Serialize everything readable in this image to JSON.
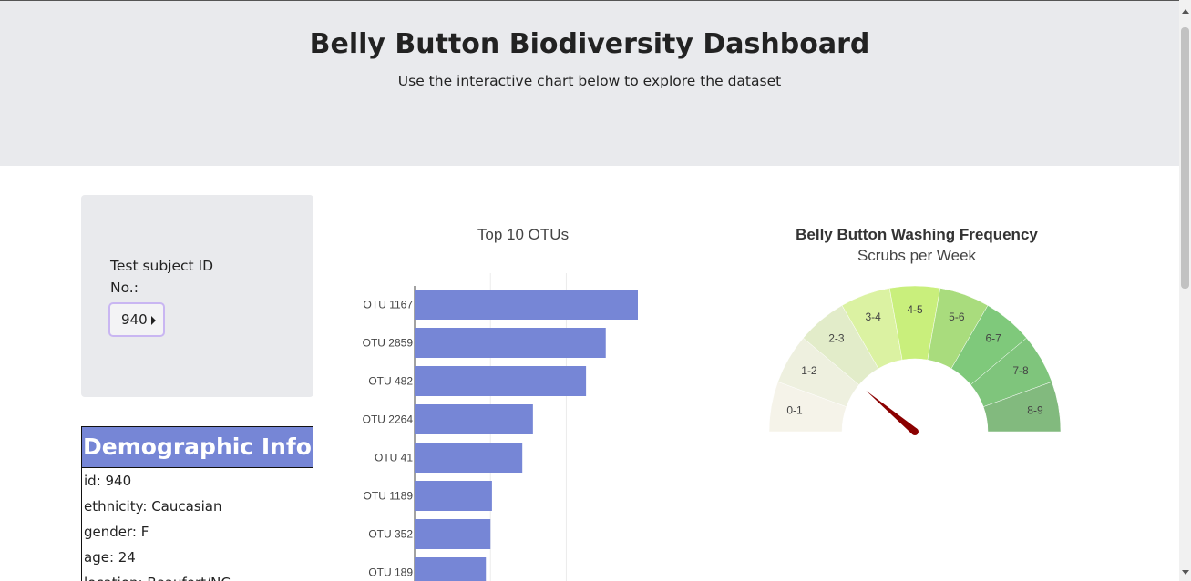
{
  "header": {
    "title": "Belly Button Biodiversity Dashboard",
    "subtitle": "Use the interactive chart below to explore the dataset"
  },
  "selector": {
    "label": "Test subject ID No.:",
    "selected_value": "940"
  },
  "demographics": {
    "heading": "Demographic Info",
    "rows": [
      "id: 940",
      "ethnicity: Caucasian",
      "gender: F",
      "age: 24",
      "location: Beaufort/NC"
    ]
  },
  "colors": {
    "header_bg": "#e9eaed",
    "bar": "#7686d6",
    "panel_heading": "#7686d6",
    "needle": "#8b0000",
    "select_border": "#c9b6f2"
  },
  "chart_data": [
    {
      "type": "bar",
      "orientation": "horizontal",
      "title": "Top 10 OTUs",
      "categories": [
        "OTU 1167",
        "OTU 2859",
        "OTU 482",
        "OTU 2264",
        "OTU 41",
        "OTU 1189",
        "OTU 352",
        "OTU 189"
      ],
      "values": [
        163,
        126,
        113,
        78,
        71,
        51,
        50,
        47
      ],
      "xlim": [
        0,
        170
      ],
      "grid": true
    },
    {
      "type": "gauge",
      "title": "Belly Button Washing Frequency",
      "subtitle": "Scrubs per Week",
      "categories": [
        "0-1",
        "1-2",
        "2-3",
        "3-4",
        "4-5",
        "5-6",
        "6-7",
        "7-8",
        "8-9"
      ],
      "colors": [
        "#f5f3e9",
        "#eef0df",
        "#e2ecc9",
        "#dbf2a2",
        "#c9ef7c",
        "#a9dc7d",
        "#7fc97b",
        "#7fc57c",
        "#82ba7e"
      ],
      "range": [
        0,
        9
      ],
      "value": 2
    }
  ]
}
